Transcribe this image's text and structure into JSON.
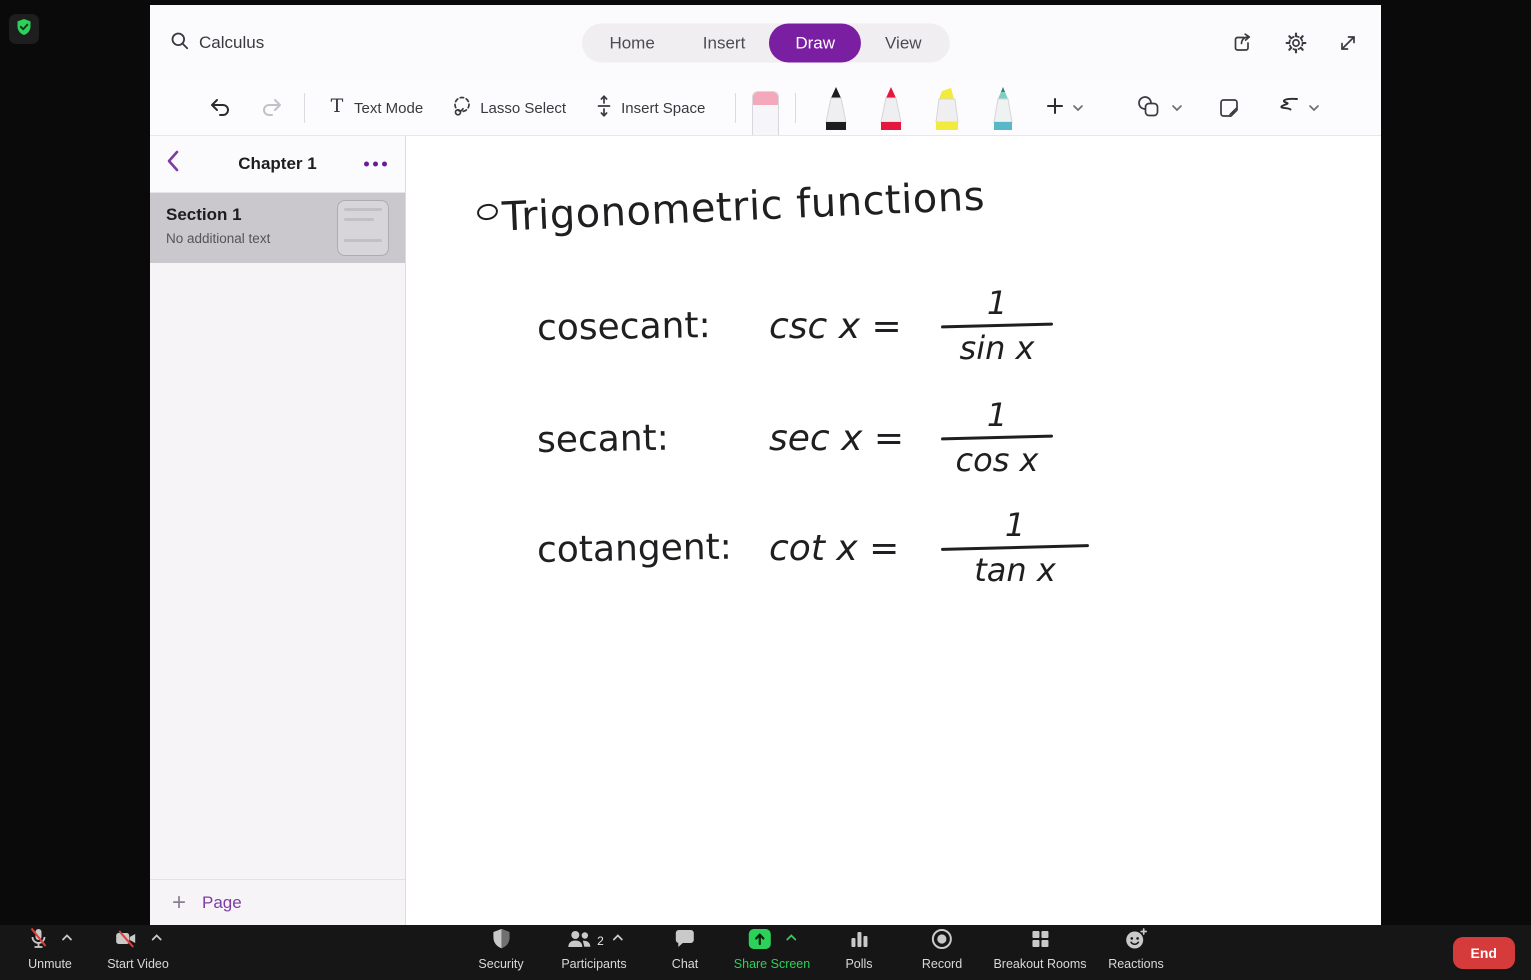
{
  "app": {
    "search": {
      "value": "Calculus"
    },
    "tabs": {
      "items": [
        "Home",
        "Insert",
        "Draw",
        "View"
      ],
      "active": "Draw"
    },
    "ribbon": {
      "text_mode": "Text Mode",
      "lasso_select": "Lasso Select",
      "insert_space": "Insert Space",
      "tools": [
        "undo",
        "redo",
        "eraser",
        "black-pen",
        "red-pen",
        "yellow-highlighter",
        "teal-pencil",
        "add-pen",
        "shapes",
        "note-page",
        "ink-scribble"
      ]
    },
    "sidebar": {
      "title": "Chapter 1",
      "sections": [
        {
          "title": "Section 1",
          "subtitle": "No additional text",
          "selected": true
        }
      ],
      "add_page_label": "Page"
    },
    "canvas": {
      "title": "Trigonometric functions",
      "formulas": [
        {
          "label": "cosecant:",
          "lhs": "csc x =",
          "numerator": "1",
          "denominator": "sin x"
        },
        {
          "label": "secant:",
          "lhs": "sec x =",
          "numerator": "1",
          "denominator": "cos x"
        },
        {
          "label": "cotangent:",
          "lhs": "cot x =",
          "numerator": "1",
          "denominator": "tan x"
        }
      ]
    }
  },
  "zoombar": {
    "unmute": {
      "label": "Unmute"
    },
    "start_video": {
      "label": "Start Video"
    },
    "security": {
      "label": "Security"
    },
    "participants": {
      "label": "Participants",
      "count": "2"
    },
    "chat": {
      "label": "Chat"
    },
    "share_screen": {
      "label": "Share Screen"
    },
    "polls": {
      "label": "Polls"
    },
    "record": {
      "label": "Record"
    },
    "breakout_rooms": {
      "label": "Breakout Rooms"
    },
    "reactions": {
      "label": "Reactions"
    },
    "end": {
      "label": "End"
    }
  },
  "icons": {
    "search": "magnifier",
    "undo": "curved-arrow-left",
    "redo": "curved-arrow-right",
    "text_mode": "serif-T",
    "lasso": "dashed-circle-rope",
    "insert_space": "up-down-arrows-line",
    "share": "box-arrow-out",
    "settings": "gear",
    "fullscreen": "diagonal-expand-arrows",
    "shapes": "circle-square",
    "note": "page-with-pen",
    "ink": "scribble",
    "security_badge": "green-shield-check",
    "mic_muted": "mic-slash",
    "video_off": "camera-slash",
    "security": "shield",
    "participants": "two-people",
    "chat": "speech-bubble",
    "share_screen": "green-box-up-arrow",
    "polls": "bar-chart",
    "record": "record-circle",
    "breakout": "grid-2x2",
    "reactions": "smiley-plus"
  },
  "colors": {
    "accent_purple": "#7B1FA2",
    "sidebar_purple": "#7D3CA3",
    "share_green": "#2BD158",
    "end_red": "#D63B3B",
    "pen_black": "#1D1D1F",
    "pen_red": "#E5173F",
    "highlighter_yellow": "#F2EA3C",
    "pencil_teal": "#7ED0C6",
    "eraser_pink": "#F3A9BB",
    "toolbar_dark": "#161616",
    "ink": "#1F1F21"
  }
}
